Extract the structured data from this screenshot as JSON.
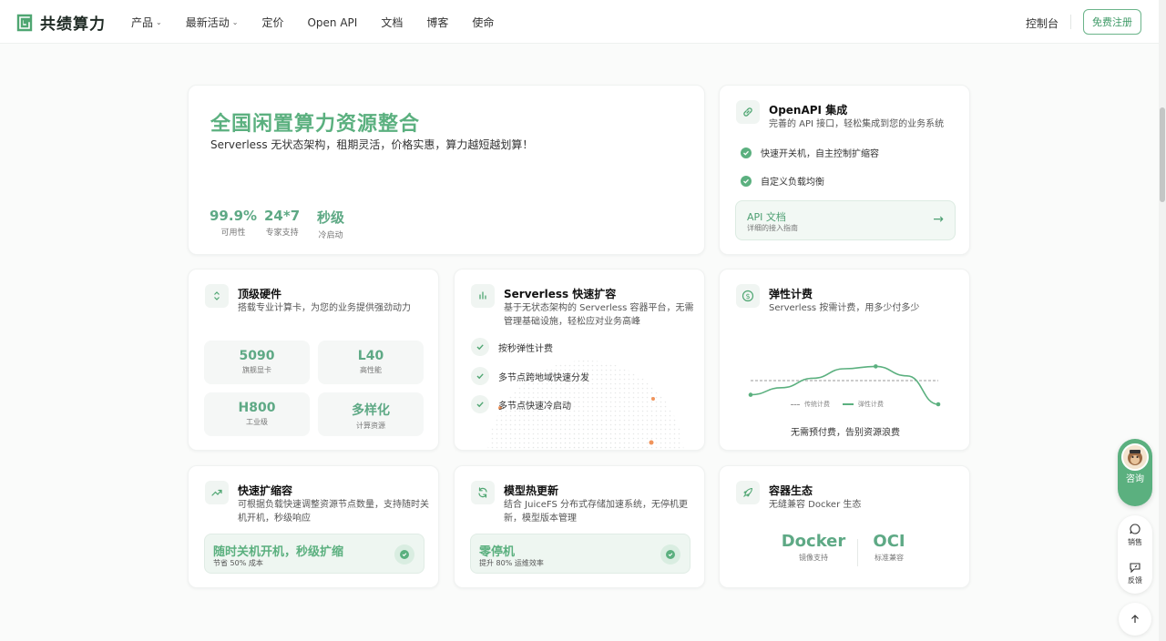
{
  "header": {
    "brand": "共绩算力",
    "nav": [
      {
        "label": "产品",
        "dropdown": true
      },
      {
        "label": "最新活动",
        "dropdown": true
      },
      {
        "label": "定价",
        "dropdown": false
      },
      {
        "label": "Open API",
        "dropdown": false
      },
      {
        "label": "文档",
        "dropdown": false
      },
      {
        "label": "博客",
        "dropdown": false
      },
      {
        "label": "使命",
        "dropdown": false
      }
    ],
    "console": "控制台",
    "signup": "免费注册"
  },
  "hero": {
    "title": "全国闲置算力资源整合",
    "subtitle": "Serverless 无状态架构，租期灵活，价格实惠，算力越短越划算！",
    "stats": [
      {
        "value": "99.9%",
        "label": "可用性"
      },
      {
        "value": "24*7",
        "label": "专家支持"
      },
      {
        "value": "秒级",
        "label": "冷启动"
      }
    ]
  },
  "openapi": {
    "title": "OpenAPI 集成",
    "desc": "完善的 API 接口，轻松集成到您的业务系统",
    "features": [
      "快速开关机，自主控制扩缩容",
      "自定义负载均衡"
    ],
    "doc_title": "API 文档",
    "doc_sub": "详细的接入指南"
  },
  "hardware": {
    "title": "顶级硬件",
    "desc": "搭载专业计算卡，为您的业务提供强劲动力",
    "tiles": [
      {
        "value": "5090",
        "label": "旗舰显卡"
      },
      {
        "value": "L40",
        "label": "高性能"
      },
      {
        "value": "H800",
        "label": "工业级"
      },
      {
        "value": "多样化",
        "label": "计算资源"
      }
    ]
  },
  "serverless": {
    "title": "Serverless 快速扩容",
    "desc": "基于无状态架构的 Serverless 容器平台，无需管理基础设施，轻松应对业务高峰",
    "features": [
      "按秒弹性计费",
      "多节点跨地域快速分发",
      "多节点快速冷启动"
    ]
  },
  "billing": {
    "title": "弹性计费",
    "desc": "Serverless 按需计费，用多少付多少",
    "legend": [
      "传统计费",
      "弹性计费"
    ],
    "caption": "无需预付费，告别资源浪费",
    "accent": "#5bb07f"
  },
  "chart_data": {
    "type": "line",
    "series": [
      {
        "name": "传统计费",
        "values": [
          0.5,
          0.5,
          0.5,
          0.5,
          0.5,
          0.5,
          0.5
        ]
      },
      {
        "name": "弹性计费",
        "values": [
          0.2,
          0.35,
          0.55,
          0.75,
          0.8,
          0.6,
          0.0
        ]
      }
    ],
    "x": [
      0,
      1,
      2,
      3,
      4,
      5,
      6
    ],
    "ylim": [
      0,
      1
    ],
    "title": "",
    "xlabel": "",
    "ylabel": "",
    "grid": false,
    "legend_position": "bottom"
  },
  "scaling": {
    "title": "快速扩缩容",
    "desc": "可根据负载快速调整资源节点数量，支持随时关机开机，秒级响应",
    "bar_title": "随时关机开机，秒级扩缩",
    "bar_sub": "节省 50% 成本"
  },
  "hotupdate": {
    "title": "模型热更新",
    "desc": "结合 JuiceFS 分布式存储加速系统，无停机更新，模型版本管理",
    "bar_title": "零停机",
    "bar_sub": "提升 80% 运维效率"
  },
  "ecosystem": {
    "title": "容器生态",
    "desc": "无缝兼容 Docker 生态",
    "items": [
      {
        "value": "Docker",
        "label": "镜像支持"
      },
      {
        "value": "OCI",
        "label": "标准兼容"
      }
    ]
  },
  "floating": {
    "consult": "咨询",
    "sales": "销售",
    "feedback": "反馈"
  }
}
